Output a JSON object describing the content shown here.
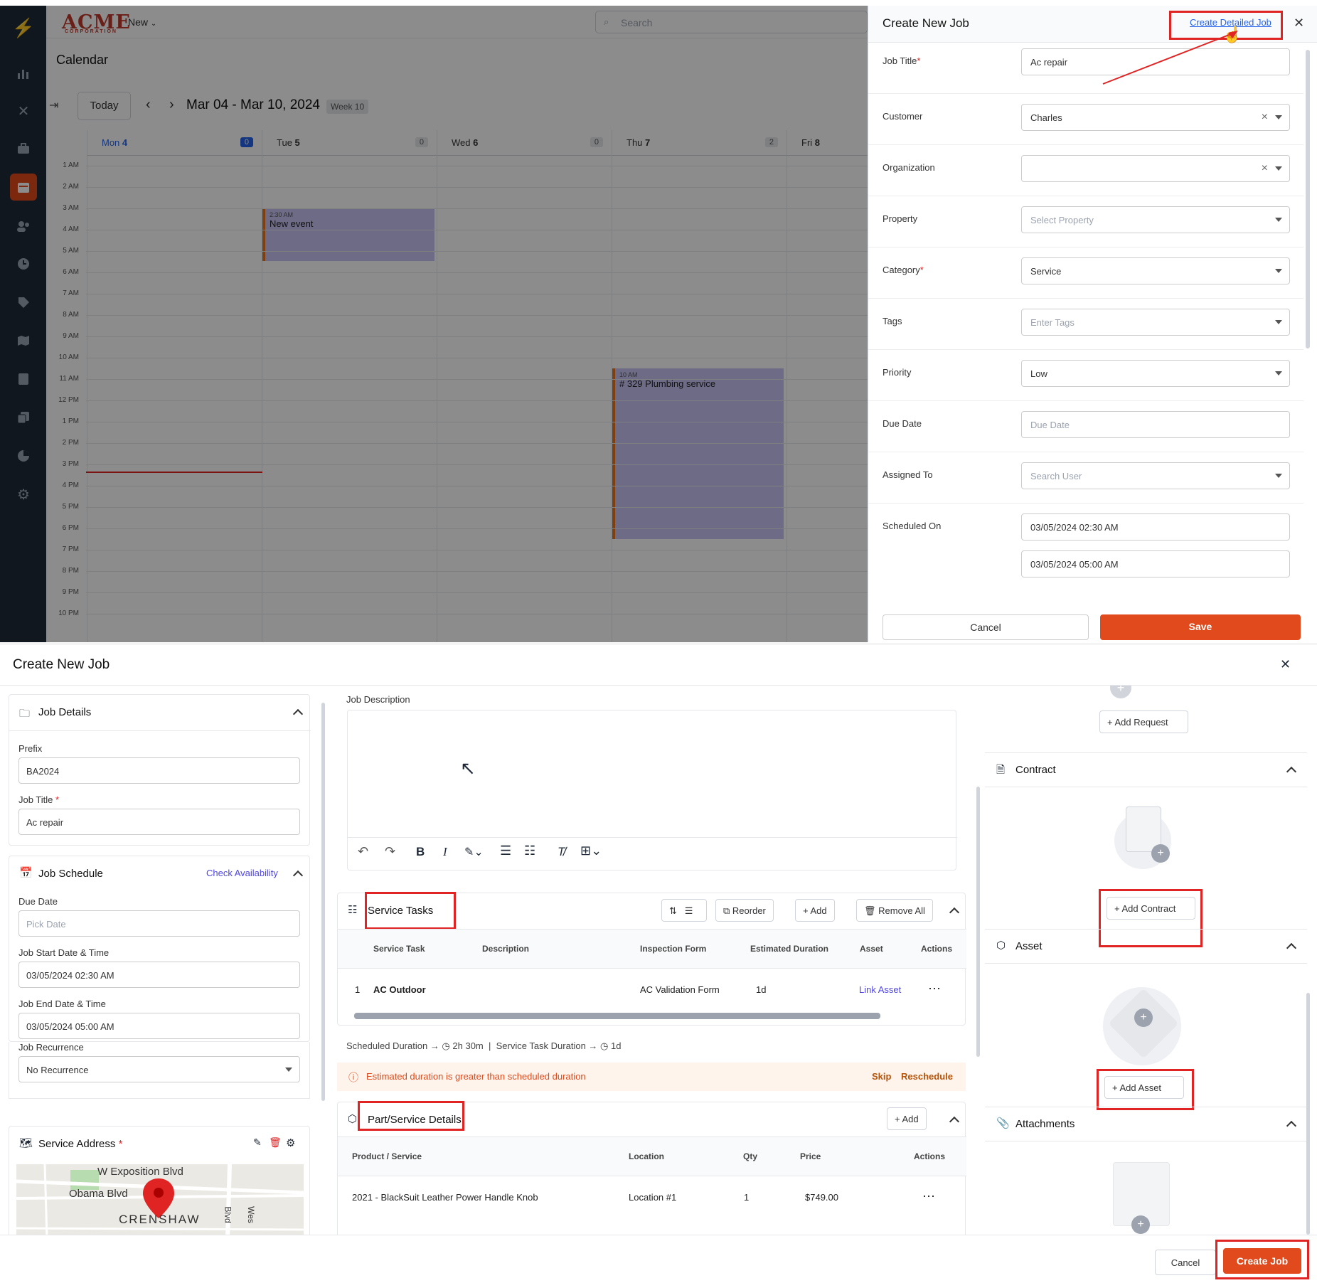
{
  "top": {
    "brand": {
      "logo": "ACME",
      "logo_sub": "CORPORATION"
    },
    "new_menu": "New",
    "search_placeholder": "Search",
    "page_title": "Calendar",
    "today_button": "Today",
    "date_range": "Mar 04 - Mar 10, 2024",
    "week_badge": "Week 10",
    "days": [
      {
        "name": "Mon",
        "num": "4",
        "count": "0"
      },
      {
        "name": "Tue",
        "num": "5",
        "count": "0"
      },
      {
        "name": "Wed",
        "num": "6",
        "count": "0"
      },
      {
        "name": "Thu",
        "num": "7",
        "count": "2"
      },
      {
        "name": "Fri",
        "num": "8",
        "count": ""
      }
    ],
    "hours": [
      "1 AM",
      "2 AM",
      "3 AM",
      "4 AM",
      "5 AM",
      "6 AM",
      "7 AM",
      "8 AM",
      "9 AM",
      "10 AM",
      "11 AM",
      "12 PM",
      "1 PM",
      "2 PM",
      "3 PM",
      "4 PM",
      "5 PM",
      "6 PM",
      "7 PM",
      "8 PM",
      "9 PM",
      "10 PM"
    ],
    "events": [
      {
        "time": "2:30 AM",
        "title": "New event"
      },
      {
        "time": "10 AM",
        "title": "# 329   Plumbing service"
      }
    ],
    "sidebar_icons": [
      "logo-icon",
      "chart-icon",
      "tools-icon",
      "briefcase-icon",
      "calendar-icon",
      "users-icon",
      "clock-icon",
      "tag-icon",
      "map-icon",
      "document-icon",
      "copy-icon",
      "pie-chart-icon",
      "gear-icon"
    ]
  },
  "panel": {
    "title": "Create New Job",
    "detailed_link": "Create Detailed Job",
    "fields": [
      {
        "label": "Job Title",
        "required": true,
        "value": "Ac repair",
        "placeholder": ""
      },
      {
        "label": "Customer",
        "required": false,
        "value": "Charles",
        "placeholder": ""
      },
      {
        "label": "Organization",
        "required": false,
        "value": "",
        "placeholder": ""
      },
      {
        "label": "Property",
        "required": false,
        "value": "",
        "placeholder": "Select Property"
      },
      {
        "label": "Category",
        "required": true,
        "value": "Service",
        "placeholder": ""
      },
      {
        "label": "Tags",
        "required": false,
        "value": "",
        "placeholder": "Enter Tags"
      },
      {
        "label": "Priority",
        "required": false,
        "value": "Low",
        "placeholder": ""
      },
      {
        "label": "Due Date",
        "required": false,
        "value": "",
        "placeholder": "Due Date"
      },
      {
        "label": "Assigned To",
        "required": false,
        "value": "",
        "placeholder": "Search User"
      },
      {
        "label": "Scheduled On",
        "required": false,
        "value": "03/05/2024 02:30 AM",
        "value2": "03/05/2024 05:00 AM"
      }
    ],
    "cancel": "Cancel",
    "save": "Save"
  },
  "detail": {
    "title": "Create New Job",
    "job_details": {
      "title": "Job Details",
      "prefix_label": "Prefix",
      "prefix_value": "BA2024",
      "job_title_label": "Job Title",
      "job_title_value": "Ac repair"
    },
    "job_schedule": {
      "title": "Job Schedule",
      "check_availability": "Check Availability",
      "due_date_label": "Due Date",
      "due_date_placeholder": "Pick Date",
      "start_label": "Job Start Date & Time",
      "start_value": "03/05/2024 02:30 AM",
      "end_label": "Job End Date & Time",
      "end_value": "03/05/2024 05:00 AM",
      "recurrence_label": "Job Recurrence",
      "recurrence_value": "No Recurrence"
    },
    "service_address": {
      "title": "Service Address",
      "map_labels": [
        "W Exposition Blvd",
        "Obama Blvd",
        "CRENSHAW",
        "Blvd",
        "Wes"
      ]
    },
    "job_description_label": "Job Description",
    "service_tasks": {
      "title": "Service Tasks",
      "reorder": "Reorder",
      "add": "Add",
      "remove_all": "Remove All",
      "columns": [
        "Service Task",
        "Description",
        "Inspection Form",
        "Estimated Duration",
        "Asset",
        "Actions"
      ],
      "rows": [
        {
          "num": "1",
          "task": "AC Outdoor",
          "description": "",
          "form": "AC Validation Form",
          "duration": "1d",
          "asset": "Link Asset"
        }
      ],
      "scheduled_duration_label": "Scheduled Duration",
      "scheduled_duration": "2h 30m",
      "task_duration_label": "Service Task Duration",
      "task_duration": "1d",
      "warning": "Estimated duration is greater than scheduled duration",
      "skip": "Skip",
      "reschedule": "Reschedule"
    },
    "parts": {
      "title": "Part/Service Details",
      "add": "Add",
      "columns": [
        "Product / Service",
        "Location",
        "Qty",
        "Price",
        "Actions"
      ],
      "rows": [
        {
          "product": "2021 - BlackSuit Leather Power Handle Knob",
          "location": "Location #1",
          "qty": "1",
          "price": "$749.00"
        }
      ]
    },
    "right": {
      "add_request": "Add Request",
      "contract_title": "Contract",
      "add_contract": "Add Contract",
      "asset_title": "Asset",
      "add_asset": "Add Asset",
      "attachments_title": "Attachments"
    },
    "cancel": "Cancel",
    "create_job": "Create Job"
  },
  "colors": {
    "accent": "#e04a1c",
    "link": "#2563eb",
    "highlight": "#e02424",
    "event": "#c7c3f5"
  }
}
